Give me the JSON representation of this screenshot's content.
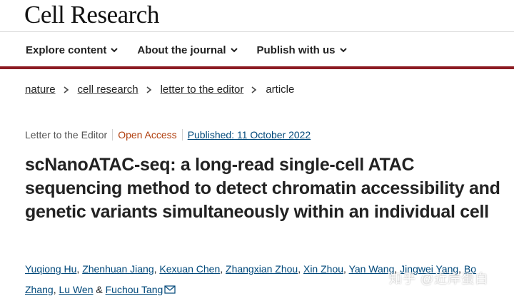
{
  "header": {
    "journal_title": "Cell Research",
    "nav": [
      {
        "label": "Explore content"
      },
      {
        "label": "About the journal"
      },
      {
        "label": "Publish with us"
      }
    ]
  },
  "breadcrumb": {
    "items": [
      "nature",
      "cell research",
      "letter to the editor"
    ],
    "current": "article"
  },
  "article": {
    "type": "Letter to the Editor",
    "access": "Open Access",
    "published": "Published: 11 October 2022",
    "title": "scNanoATAC-seq: a long-read single-cell ATAC sequencing method to detect chromatin accessibility and genetic variants simultaneously within an individual cell",
    "authors": [
      "Yuqiong Hu",
      "Zhenhuan Jiang",
      "Kexuan Chen",
      "Zhangxian Zhou",
      "Xin Zhou",
      "Yan Wang",
      "Jingwei Yang",
      "Bo Zhang",
      "Lu Wen",
      "Fuchou Tang"
    ],
    "author_separator": ", ",
    "author_last_joiner": " & "
  },
  "watermark": "知乎 @近岸蛋白",
  "colors": {
    "brand_rule": "#8c1b22",
    "link": "#00487a",
    "open_access": "#b1400f"
  }
}
